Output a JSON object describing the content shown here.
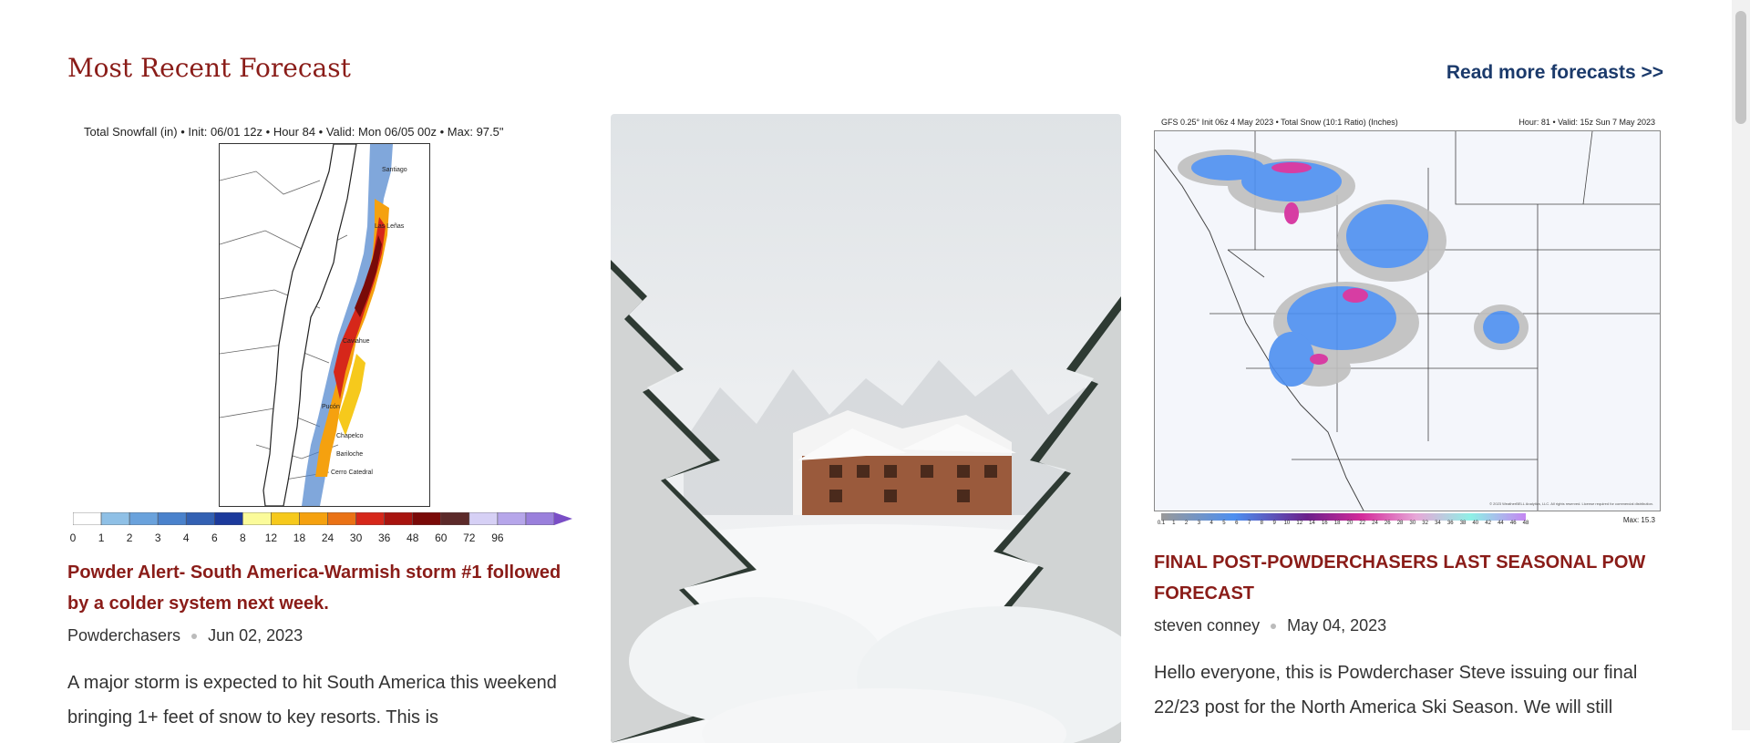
{
  "section": {
    "title": "Most Recent Forecast",
    "read_more": "Read more forecasts >>"
  },
  "posts": [
    {
      "image": {
        "caption": "Total Snowfall (in) • Init: 06/01 12z • Hour 84 • Valid: Mon 06/05 00z • Max: 97.5\"",
        "places": [
          "Santiago",
          "Las Leñas",
          "Caviahue",
          "Pucón",
          "Chapelco",
          "Bariloche",
          "Cerro Catedral"
        ],
        "scale_ticks": [
          "0",
          "1",
          "2",
          "3",
          "4",
          "6",
          "8",
          "12",
          "18",
          "24",
          "30",
          "36",
          "48",
          "60",
          "72",
          "96"
        ],
        "scale_colors": [
          "#ffffff",
          "#8fc0e6",
          "#6aa2dc",
          "#4a82cc",
          "#3361b3",
          "#1c3a9c",
          "#fbfb9a",
          "#f6c91c",
          "#f5a10f",
          "#ea7215",
          "#d6271a",
          "#a8140f",
          "#7a0a08",
          "#5c2a2a",
          "#d6d0f5",
          "#b6a6ea",
          "#9a80dc",
          "#7a4ec6"
        ]
      },
      "title": "Powder Alert- South America-Warmish storm #1 followed by a colder system next week.",
      "author": "Powderchasers",
      "date": "Jun 02, 2023",
      "excerpt": "A major storm is expected to hit South America this weekend bringing 1+ feet of snow to key resorts. This is"
    },
    {
      "image": {
        "alt": "Snow covered lodge in the forest"
      }
    },
    {
      "image": {
        "header_left": "GFS 0.25° Init 06z 4 May 2023 • Total Snow (10:1 Ratio) (Inches)",
        "header_right": "Hour: 81 • Valid: 15z Sun 7 May 2023",
        "scale_ticks": [
          "0.1",
          "1",
          "2",
          "3",
          "4",
          "5",
          "6",
          "7",
          "8",
          "9",
          "10",
          "12",
          "14",
          "16",
          "18",
          "20",
          "22",
          "24",
          "26",
          "28",
          "30",
          "32",
          "34",
          "36",
          "38",
          "40",
          "42",
          "44",
          "46",
          "48"
        ],
        "max_label": "Max: 15.3",
        "copyright": "© 2023 WeatherBELL Analytics, LLC. All rights reserved. License required for commercial distribution."
      },
      "title": "FINAL POST-POWDERCHASERS LAST SEASONAL POW FORECAST",
      "author": "steven conney",
      "date": "May 04, 2023",
      "excerpt": "Hello everyone, this is Powderchaser Steve issuing our final 22/23 post for the North America Ski Season. We will still"
    }
  ],
  "colors": {
    "accent": "#8a1c18",
    "link": "#1b3a6b",
    "text": "#333333"
  }
}
